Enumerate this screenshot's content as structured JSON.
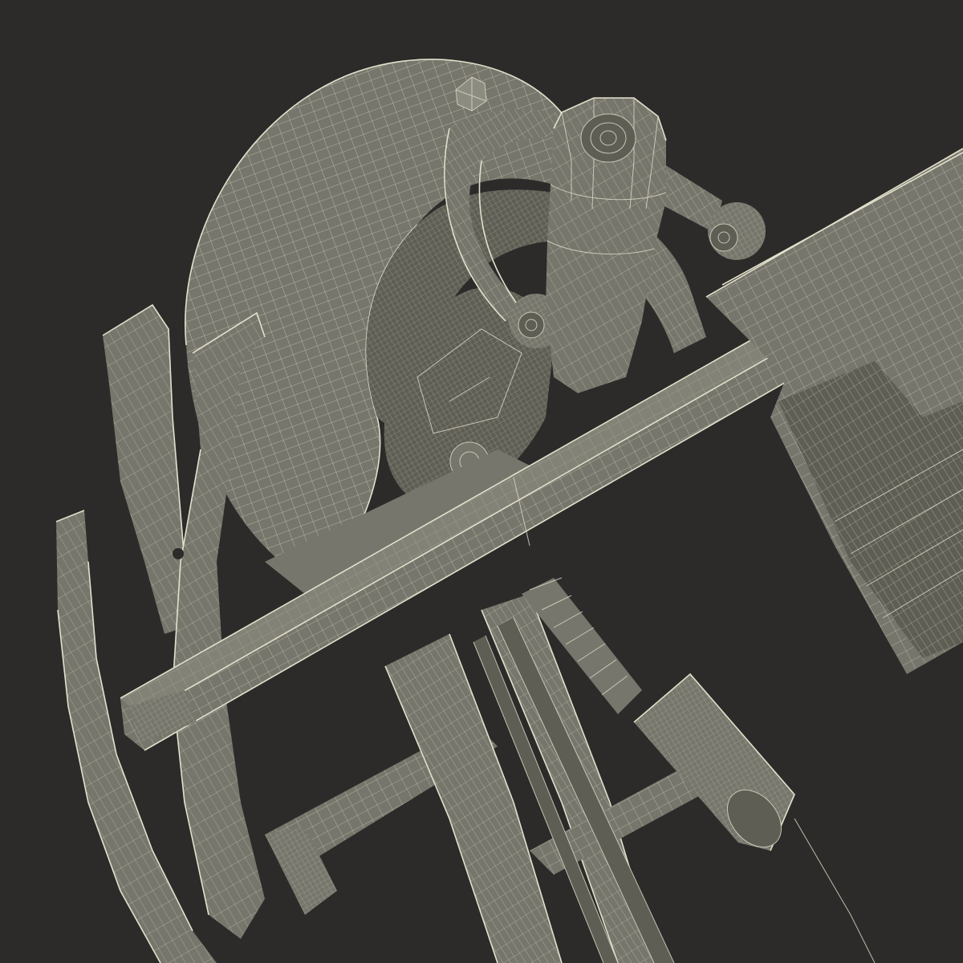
{
  "scene": {
    "background_color": "#2c2b29",
    "mesh_fill_color": "#77766c",
    "wire_color": "#d9d6c3",
    "parts": [
      "wheel",
      "suspension-strut",
      "control-arm",
      "brake-assembly",
      "axle-beam",
      "chassis-frame-rail",
      "bumper-rail",
      "steering-rack",
      "steering-boot",
      "battery-pack",
      "cross-member"
    ]
  }
}
